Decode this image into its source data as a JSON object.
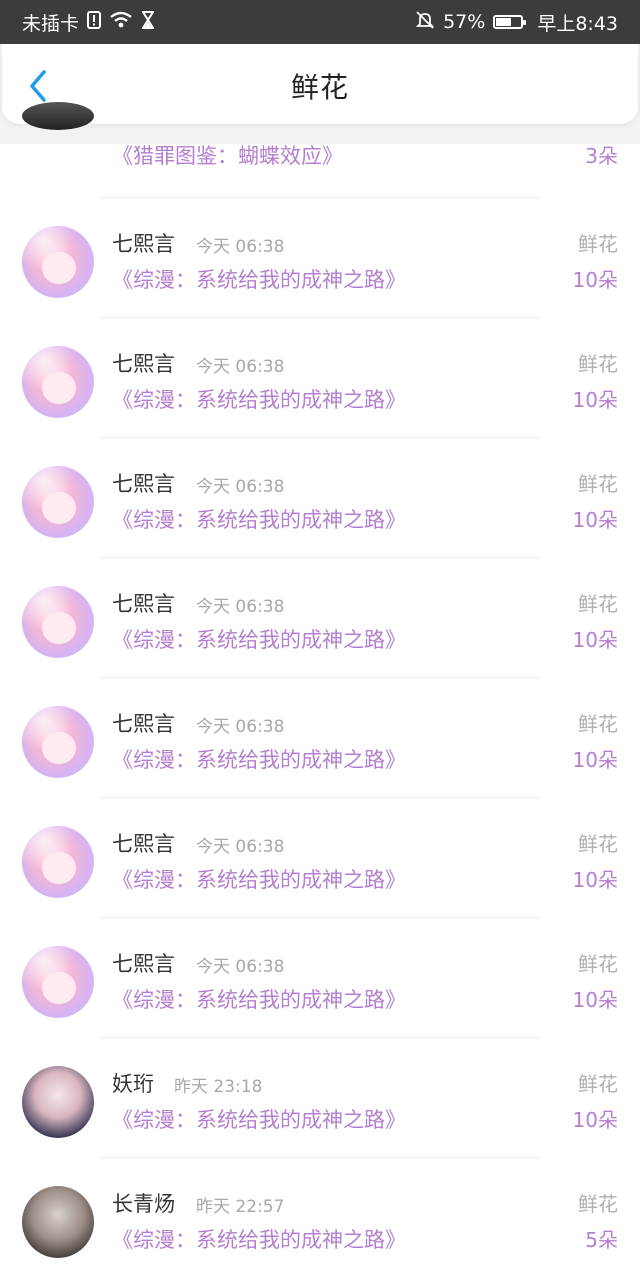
{
  "status_bar": {
    "left_text": "未插卡",
    "battery": "57%",
    "battery_level": 0.57,
    "time": "早上8:43"
  },
  "header": {
    "title": "鲜花"
  },
  "top_partial": {
    "book": "《猎罪图鉴：蝴蝶效应》",
    "count": "3朵"
  },
  "items": [
    {
      "name": "七熙言",
      "time": "今天 06:38",
      "book": "《综漫：系统给我的成神之路》",
      "type": "鲜花",
      "count": "10朵",
      "avatar": "anime-girl-avatar"
    },
    {
      "name": "七熙言",
      "time": "今天 06:38",
      "book": "《综漫：系统给我的成神之路》",
      "type": "鲜花",
      "count": "10朵",
      "avatar": "anime-girl-avatar"
    },
    {
      "name": "七熙言",
      "time": "今天 06:38",
      "book": "《综漫：系统给我的成神之路》",
      "type": "鲜花",
      "count": "10朵",
      "avatar": "anime-girl-avatar"
    },
    {
      "name": "七熙言",
      "time": "今天 06:38",
      "book": "《综漫：系统给我的成神之路》",
      "type": "鲜花",
      "count": "10朵",
      "avatar": "anime-girl-avatar"
    },
    {
      "name": "七熙言",
      "time": "今天 06:38",
      "book": "《综漫：系统给我的成神之路》",
      "type": "鲜花",
      "count": "10朵",
      "avatar": "anime-girl-avatar"
    },
    {
      "name": "七熙言",
      "time": "今天 06:38",
      "book": "《综漫：系统给我的成神之路》",
      "type": "鲜花",
      "count": "10朵",
      "avatar": "anime-girl-avatar"
    },
    {
      "name": "七熙言",
      "time": "今天 06:38",
      "book": "《综漫：系统给我的成神之路》",
      "type": "鲜花",
      "count": "10朵",
      "avatar": "anime-girl-avatar"
    },
    {
      "name": "妖珩",
      "time": "昨天 23:18",
      "book": "《综漫：系统给我的成神之路》",
      "type": "鲜花",
      "count": "10朵",
      "avatar": "anime-couple-avatar"
    },
    {
      "name": "长青炀",
      "time": "昨天 22:57",
      "book": "《综漫：系统给我的成神之路》",
      "type": "鲜花",
      "count": "5朵",
      "avatar": "photo-man-avatar"
    }
  ],
  "colors": {
    "accent": "#1e9bea",
    "book_purple": "#b57fd1",
    "status_bar": "#3c3c3c"
  }
}
